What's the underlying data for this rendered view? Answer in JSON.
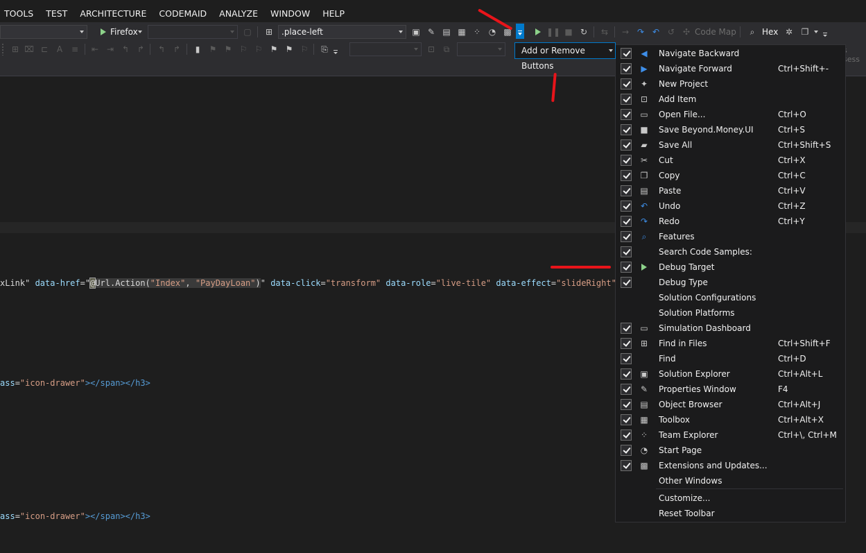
{
  "menubar": {
    "items": [
      "TOOLS",
      "TEST",
      "ARCHITECTURE",
      "CODEMAID",
      "ANALYZE",
      "WINDOW",
      "HELP"
    ]
  },
  "toolbar": {
    "browser_label": "Firefox",
    "selector_value": ".place-left",
    "code_map_label": "Code Map",
    "hex_label": "Hex",
    "add_remove_label": "Add or Remove Buttons",
    "faded_text": "s sess"
  },
  "editor": {
    "line1": {
      "p1": "xLink\" ",
      "a1": "data-href",
      "p2": "=\"",
      "at": "@",
      "razor1": "Url.Action(",
      "s1": "\"Index\"",
      "razor2": ", ",
      "s2": "\"PayDayLoan\"",
      "razor3": ")",
      "p3": "\" ",
      "a2": "data-click",
      "p4": "=",
      "s3": "\"transform\"",
      "sp1": " ",
      "a3": "data-role",
      "p5": "=",
      "s4": "\"live-tile\"",
      "sp2": " ",
      "a4": "data-effect",
      "p6": "=",
      "s5": "\"slideRight\"",
      "p7": ">"
    },
    "line2": {
      "a": "ass",
      "eq": "=",
      "s": "\"icon-drawer\"",
      "t1": "></",
      "tag1": "span",
      "t2": "></",
      "tag2": "h3",
      "t3": ">"
    },
    "line3": {
      "a": "ass",
      "eq": "=",
      "s": "\"icon-drawer\"",
      "t1": "></",
      "tag1": "span",
      "t2": "></",
      "tag2": "h3",
      "t3": ">"
    }
  },
  "dropdown": {
    "items": [
      {
        "label": "Navigate Backward",
        "shortcut": "",
        "checked": true,
        "icon": "navigate-backward-icon"
      },
      {
        "label": "Navigate Forward",
        "shortcut": "Ctrl+Shift+-",
        "checked": true,
        "icon": "navigate-forward-icon"
      },
      {
        "label": "New Project",
        "shortcut": "",
        "checked": true,
        "icon": "new-project-icon"
      },
      {
        "label": "Add Item",
        "shortcut": "",
        "checked": true,
        "icon": "add-item-icon"
      },
      {
        "label": "Open File...",
        "shortcut": "Ctrl+O",
        "checked": true,
        "icon": "open-file-icon"
      },
      {
        "label": "Save Beyond.Money.UI",
        "shortcut": "Ctrl+S",
        "checked": true,
        "icon": "save-icon"
      },
      {
        "label": "Save All",
        "shortcut": "Ctrl+Shift+S",
        "checked": true,
        "icon": "save-all-icon"
      },
      {
        "label": "Cut",
        "shortcut": "Ctrl+X",
        "checked": true,
        "icon": "cut-icon"
      },
      {
        "label": "Copy",
        "shortcut": "Ctrl+C",
        "checked": true,
        "icon": "copy-icon"
      },
      {
        "label": "Paste",
        "shortcut": "Ctrl+V",
        "checked": true,
        "icon": "paste-icon"
      },
      {
        "label": "Undo",
        "shortcut": "Ctrl+Z",
        "checked": true,
        "icon": "undo-icon"
      },
      {
        "label": "Redo",
        "shortcut": "Ctrl+Y",
        "checked": true,
        "icon": "redo-icon"
      },
      {
        "label": "Features",
        "shortcut": "",
        "checked": true,
        "icon": "features-search-icon"
      },
      {
        "label": "Search Code Samples:",
        "shortcut": "",
        "checked": true,
        "icon": ""
      },
      {
        "label": "Debug Target",
        "shortcut": "",
        "checked": true,
        "icon": "debug-target-play-icon"
      },
      {
        "label": "Debug Type",
        "shortcut": "",
        "checked": true,
        "icon": ""
      },
      {
        "label": "Solution Configurations",
        "shortcut": "",
        "checked": false,
        "icon": ""
      },
      {
        "label": "Solution Platforms",
        "shortcut": "",
        "checked": false,
        "icon": ""
      },
      {
        "label": "Simulation Dashboard",
        "shortcut": "",
        "checked": true,
        "icon": "simulation-dashboard-icon"
      },
      {
        "label": "Find in Files",
        "shortcut": "Ctrl+Shift+F",
        "checked": true,
        "icon": "find-in-files-icon"
      },
      {
        "label": "Find",
        "shortcut": "Ctrl+D",
        "checked": true,
        "icon": ""
      },
      {
        "label": "Solution Explorer",
        "shortcut": "Ctrl+Alt+L",
        "checked": true,
        "icon": "solution-explorer-icon"
      },
      {
        "label": "Properties Window",
        "shortcut": "F4",
        "checked": true,
        "icon": "properties-wrench-icon"
      },
      {
        "label": "Object Browser",
        "shortcut": "Ctrl+Alt+J",
        "checked": true,
        "icon": "object-browser-icon"
      },
      {
        "label": "Toolbox",
        "shortcut": "Ctrl+Alt+X",
        "checked": true,
        "icon": "toolbox-icon"
      },
      {
        "label": "Team Explorer",
        "shortcut": "Ctrl+\\, Ctrl+M",
        "checked": true,
        "icon": "team-explorer-icon"
      },
      {
        "label": "Start Page",
        "shortcut": "",
        "checked": true,
        "icon": "start-page-icon"
      },
      {
        "label": "Extensions and Updates...",
        "shortcut": "",
        "checked": true,
        "icon": "extensions-icon"
      },
      {
        "label": "Other Windows",
        "shortcut": "",
        "checked": false,
        "icon": ""
      }
    ],
    "customize_label": "Customize...",
    "reset_label": "Reset Toolbar"
  }
}
